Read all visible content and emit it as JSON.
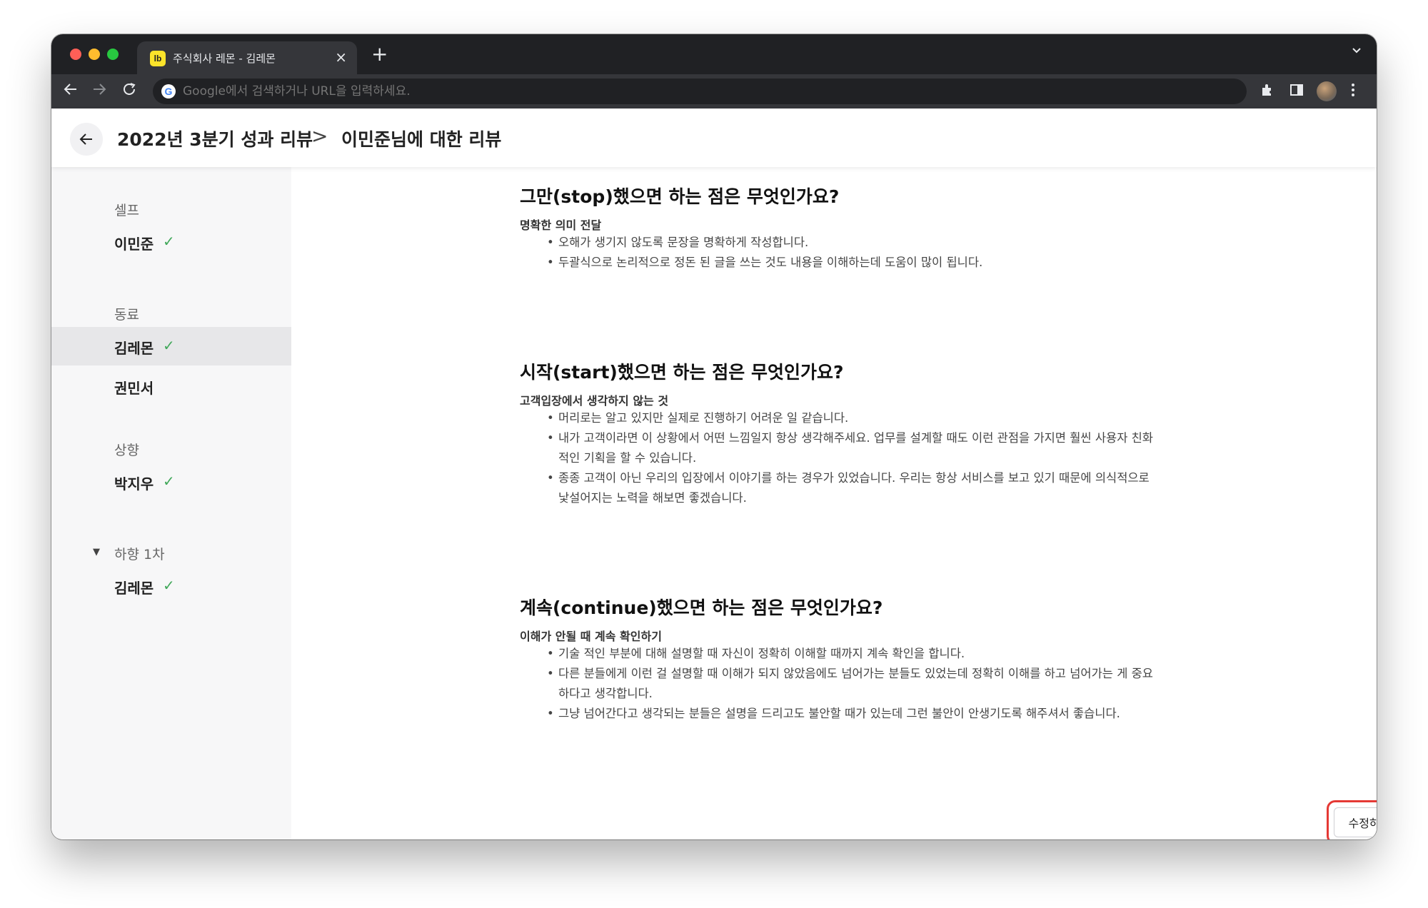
{
  "browser": {
    "tab_title": "주식회사 레몬 - 김레몬",
    "tab_favicon_text": "lb",
    "close_glyph": "×",
    "new_tab_glyph": "+",
    "address_placeholder": "Google에서 검색하거나 URL을 입력하세요.",
    "icons": [
      "back-arrow-icon",
      "forward-arrow-icon",
      "reload-icon",
      "google-icon",
      "extensions-icon",
      "side-panel-icon",
      "profile-avatar",
      "more-menu-icon"
    ]
  },
  "header": {
    "breadcrumb_root": "2022년 3분기 성과 리뷰",
    "breadcrumb_separator": ">",
    "breadcrumb_current": "이민준님에 대한 리뷰"
  },
  "sidebar": {
    "groups": [
      {
        "label": "셀프",
        "items": [
          {
            "name": "이민준",
            "done": true
          }
        ]
      },
      {
        "label": "동료",
        "items": [
          {
            "name": "김레몬",
            "done": true,
            "active": true
          },
          {
            "name": "권민서",
            "done": false
          }
        ]
      },
      {
        "label": "상향",
        "items": [
          {
            "name": "박지우",
            "done": true
          }
        ]
      },
      {
        "label": "하향 1차",
        "collapsible": true,
        "items": [
          {
            "name": "김레몬",
            "done": true
          }
        ]
      }
    ],
    "check_glyph": "✓",
    "caret_glyph": "▼",
    "check_color": "#41a85a"
  },
  "sections": [
    {
      "title": "그만(stop)했으면 하는 점은 무엇인가요?",
      "subtitle": "명확한 의미 전달",
      "bullets": [
        "오해가 생기지 않도록 문장을 명확하게 작성합니다.",
        "두괄식으로 논리적으로 정돈 된 글을 쓰는 것도 내용을 이해하는데 도움이 많이 됩니다."
      ]
    },
    {
      "title": "시작(start)했으면 하는 점은 무엇인가요?",
      "subtitle": "고객입장에서 생각하지 않는 것",
      "bullets": [
        "머리로는 알고 있지만 실제로 진행하기 어려운 일 같습니다.",
        "내가 고객이라면 이 상황에서 어떤 느낌일지 항상 생각해주세요. 업무를 설계할 때도 이런 관점을 가지면 훨씬 사용자 친화적인 기획을 할 수 있습니다.",
        "종종 고객이 아닌 우리의 입장에서 이야기를 하는 경우가 있었습니다. 우리는 항상 서비스를 보고 있기 때문에 의식적으로 낯설어지는 노력을 해보면 좋겠습니다."
      ]
    },
    {
      "title": "계속(continue)했으면 하는 점은 무엇인가요?",
      "subtitle": "이해가 안될 때 계속 확인하기",
      "bullets": [
        "기술 적인 부분에 대해 설명할 때 자신이 정확히 이해할 때까지 계속 확인을 합니다.",
        "다른 분들에게 이런 걸 설명할 때 이해가 되지 않았음에도 넘어가는 분들도 있었는데 정확히 이해를 하고 넘어가는 게 중요하다고 생각합니다.",
        "그냥 넘어간다고 생각되는 분들은 설명을 드리고도 불안할 때가 있는데 그런 불안이 안생기도록 해주셔서 좋습니다."
      ]
    }
  ],
  "bullet_glyph": "•",
  "edit_button_label": "수정하기",
  "highlight_color": "#e53935"
}
